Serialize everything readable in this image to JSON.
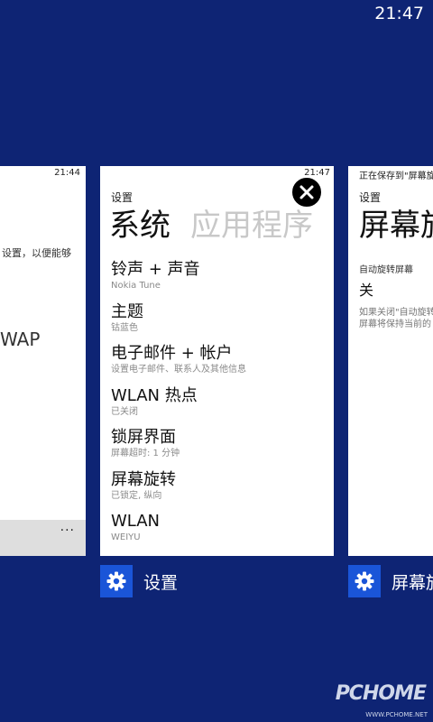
{
  "status_bar": {
    "time": "21:47"
  },
  "left_card": {
    "time": "21:44",
    "text1": "设置，以便能够",
    "text2": "WAP",
    "more": "···"
  },
  "center_card": {
    "time": "21:47",
    "breadcrumb": "设置",
    "pivot_active": "系统",
    "pivot_inactive": "应用程序",
    "items": [
      {
        "title": "铃声 + 声音",
        "subtitle": "Nokia Tune"
      },
      {
        "title": "主题",
        "subtitle": "钴蓝色"
      },
      {
        "title": "电子邮件 + 帐户",
        "subtitle": "设置电子邮件、联系人及其他信息"
      },
      {
        "title": "WLAN 热点",
        "subtitle": "已关闭"
      },
      {
        "title": "锁屏界面",
        "subtitle": "屏幕超时: 1 分钟"
      },
      {
        "title": "屏幕旋转",
        "subtitle": "已锁定, 纵向"
      },
      {
        "title": "WLAN",
        "subtitle": "WEIYU"
      }
    ]
  },
  "right_card": {
    "status": "正在保存到\"屏幕旋",
    "breadcrumb": "设置",
    "title": "屏幕旋",
    "label": "自动旋转屏幕",
    "value": "关",
    "desc1": "如果关闭\"自动旋转",
    "desc2": "屏幕将保持当前的"
  },
  "app_labels": {
    "center": "设置",
    "right": "屏幕旋"
  },
  "watermark": {
    "text": "PCHOME",
    "url": "WWW.PCHOME.NET"
  },
  "colors": {
    "background": "#0e2474",
    "accent": "#1a55d8"
  }
}
